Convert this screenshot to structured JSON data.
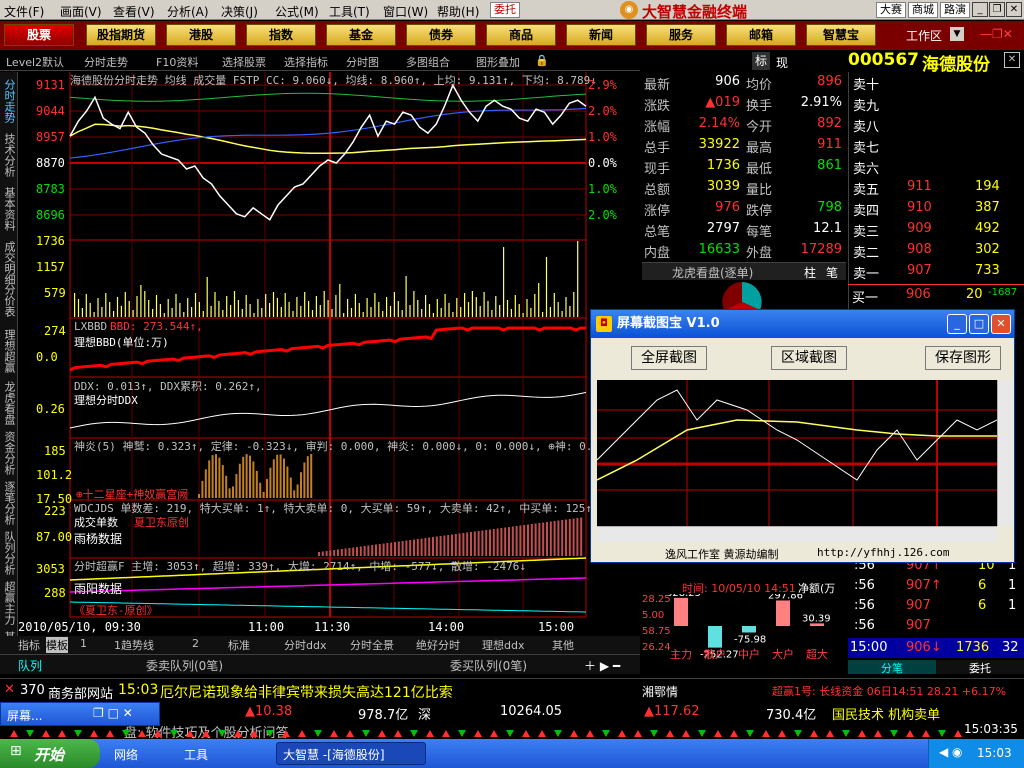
{
  "menu": {
    "items": [
      "文件(F)",
      "画面(V)",
      "查看(V)",
      "分析(A)",
      "决策(J)",
      "公式(M)",
      "工具(T)",
      "窗口(W)",
      "帮助(H)"
    ],
    "entrust": "委托",
    "app_title": "大智慧金融终端",
    "right": [
      "大赛",
      "商城",
      "路演"
    ]
  },
  "nav": {
    "buttons": [
      "股票",
      "股指期货",
      "港股",
      "指数",
      "基金",
      "债券",
      "商品",
      "新闻",
      "服务",
      "邮箱",
      "智慧宝"
    ],
    "workspace": "工作区"
  },
  "subbar": {
    "items": [
      "Level2默认",
      "分时走势",
      "F10资料",
      "选择股票",
      "选择指标",
      "分时图",
      "多图组合",
      "图形叠加"
    ],
    "tabs": [
      "标",
      "现"
    ]
  },
  "stock": {
    "code": "000567",
    "name": "海德股份"
  },
  "side_tabs": [
    "分时走势",
    "技术分析",
    "基本资料",
    "成交明细",
    "分价表",
    "理想超赢",
    "龙虎看盘",
    "资金分析",
    "逐笔分析",
    "队列分析",
    "超赢主力",
    "其他"
  ],
  "chart": {
    "header": "海德股份分时走势 均线 成交量 FSTP CC: 9.060↓, 均线: 8.960↑, 上均: 9.131↑, 下均: 8.789↓",
    "price_axis": [
      "9131",
      "9044",
      "8957",
      "8870",
      "8783",
      "8696"
    ],
    "pct_axis": [
      "2.9%",
      "2.0%",
      "1.0%",
      "0.0%",
      "1.0%",
      "2.0%"
    ],
    "vol_axis": [
      "1736",
      "1157",
      "579"
    ],
    "p2": {
      "title": "LXBBD",
      "l1": "BBD: 273.544↑,",
      "l2": "理想BBD(单位:万)",
      "axis": [
        "274",
        "0.0"
      ]
    },
    "p3": {
      "title": "LXFSDDX",
      "l1": "DDX: 0.013↑, DDX累积: 0.262↑,",
      "l2": "理想分时DDX",
      "axis": [
        "0.26"
      ]
    },
    "p4": {
      "l1": "神炎(5) 神鹫: 0.323↑, 定律: -0.323↓, 审判: 0.000, 神炎: 0.000↓, 0: 0.000↓, ⊕神: 0.000",
      "axis": [
        "185",
        "101.2",
        "17.50"
      ],
      "note": "⊕十二星座+神奴赢宫阙"
    },
    "p5": {
      "l1": "WDCJDS 单数差: 219, 特大买单: 1↑, 特大卖单: 0, 大买单: 59↑, 大卖单: 42↑, 中买单: 125↑,",
      "l2": "成交单数",
      "l3": "雨杨数据",
      "l4": "夏卫东原创",
      "axis": [
        "223",
        "87.00"
      ]
    },
    "p6": {
      "l1": "分时超赢F 主增: 3053↑, 超增: 339↑, 大增: 2714↑, 中增: -577↓, 散增: -2476↓",
      "l2": "雨阳数据",
      "l3": "《夏卫东-原创》",
      "axis": [
        "3053",
        "288"
      ]
    },
    "times": [
      "2010/05/10, 09:30",
      "11:00",
      "11:30",
      "14:00",
      "15:00"
    ],
    "price_line": [
      8960,
      9010,
      9044,
      9090,
      9020,
      9000,
      8985,
      9040,
      8990,
      8970,
      8930,
      8900,
      8890,
      8880,
      8850,
      8860,
      8820,
      8800,
      8760,
      8730,
      8700,
      8690,
      8720,
      8700,
      8680,
      8730,
      8760,
      8790,
      8800,
      8830,
      8860,
      8880,
      8870,
      8900,
      8940,
      8990,
      9030,
      8960,
      9010,
      9000,
      9040,
      9030,
      8990,
      8970,
      9000,
      9060,
      9130,
      9080,
      9040,
      9010,
      9060,
      9080,
      9060,
      9050,
      9020,
      9010,
      9050,
      9040,
      9000,
      9030,
      9070,
      9080,
      9060
    ]
  },
  "quote": {
    "left": [
      [
        "最新",
        "906",
        "wht"
      ],
      [
        "涨跌",
        "▲019",
        "red"
      ],
      [
        "涨幅",
        "2.14%",
        "red"
      ],
      [
        "总手",
        "33922",
        "yel"
      ],
      [
        "现手",
        "1736",
        "yel"
      ],
      [
        "总额",
        "3039",
        "yel"
      ],
      [
        "涨停",
        "976",
        "red"
      ],
      [
        "总笔",
        "2797",
        "wht"
      ],
      [
        "内盘",
        "16633",
        "grn"
      ]
    ],
    "right": [
      [
        "均价",
        "896",
        "red"
      ],
      [
        "换手",
        "2.91%",
        "wht"
      ],
      [
        "今开",
        "892",
        "red"
      ],
      [
        "最高",
        "911",
        "red"
      ],
      [
        "最低",
        "861",
        "grn"
      ],
      [
        "量比",
        "",
        "wht"
      ],
      [
        "跌停",
        "798",
        "grn"
      ],
      [
        "每笔",
        "12.1",
        "wht"
      ],
      [
        "外盘",
        "17289",
        "red"
      ]
    ],
    "sells": [
      [
        "卖十",
        "",
        ""
      ],
      [
        "卖九",
        "",
        ""
      ],
      [
        "卖八",
        "",
        ""
      ],
      [
        "卖七",
        "",
        ""
      ],
      [
        "卖六",
        "",
        ""
      ],
      [
        "卖五",
        "911",
        "194"
      ],
      [
        "卖四",
        "910",
        "387"
      ],
      [
        "卖三",
        "909",
        "492"
      ],
      [
        "卖二",
        "908",
        "302"
      ],
      [
        "卖一",
        "907",
        "733"
      ]
    ],
    "buy1": [
      "买一",
      "906",
      "20",
      "-1687"
    ],
    "dragon": "龙虎看盘(逐单)",
    "dragon_tabs": [
      "柱",
      "笔"
    ],
    "trades": [
      [
        ":56",
        "907↑",
        "10",
        "1"
      ],
      [
        ":56",
        "907↑",
        "6",
        "1"
      ],
      [
        ":56",
        "907",
        "6",
        "1"
      ],
      [
        ":56",
        "907",
        "",
        ""
      ]
    ],
    "last": [
      "15:00",
      "906↓",
      "1736",
      "32"
    ],
    "tabs": [
      "分笔",
      "委托"
    ],
    "bar_time": "时间: 10/05/10 14:51",
    "bar_sub": "净额(万",
    "bars": [
      {
        "label": "主力",
        "value": 328.25
      },
      {
        "label": "散户",
        "value": -252.27
      },
      {
        "label": "中户",
        "value": -75.98
      },
      {
        "label": "大户",
        "value": 297.86
      },
      {
        "label": "超大",
        "value": 30.39
      }
    ],
    "bar_axis": [
      "28.25",
      "5.00",
      "58.75",
      "26.24"
    ]
  },
  "popup": {
    "title": "屏幕截图宝  V1.0",
    "buttons": [
      "全屏截图",
      "区域截图",
      "保存图形"
    ],
    "footer_left": "逸风工作室 黄源劫编制",
    "footer_right": "http://yfhhj.126.com"
  },
  "bottom": {
    "tabs": [
      "指标",
      "模板",
      "1",
      "1趋势线",
      "2",
      "标准",
      "分时ddx",
      "分时全景",
      "绝好分时",
      "理想ddx",
      "其他"
    ],
    "sell_queue": "委卖队列(0笔)",
    "buy_queue": "委买队列(0笔)",
    "queue_tab": "队列"
  },
  "ticker": {
    "code": "370",
    "source": "商务部网站",
    "time": "15:03",
    "headline": "厄尔尼诺现象给非律宾带来损失高达121亿比索",
    "city": "湘鄂情",
    "right": "超赢1号: 长线资金 06日14:51 28.21 +6.17%"
  },
  "status": {
    "items": [
      "▲10.38",
      "978.7亿",
      "深",
      "10264.05",
      "▲117.62",
      "730.4亿",
      "国民技术 机构卖单"
    ],
    "clock": "15:03:35",
    "hint": "盘: 软件技巧及个股分析问答"
  },
  "taskbar": {
    "start": "开始",
    "items": [
      "网络",
      "工具"
    ],
    "app": "大智慧 -[海德股份]",
    "clock": "15:03",
    "mini": "屏幕..."
  }
}
